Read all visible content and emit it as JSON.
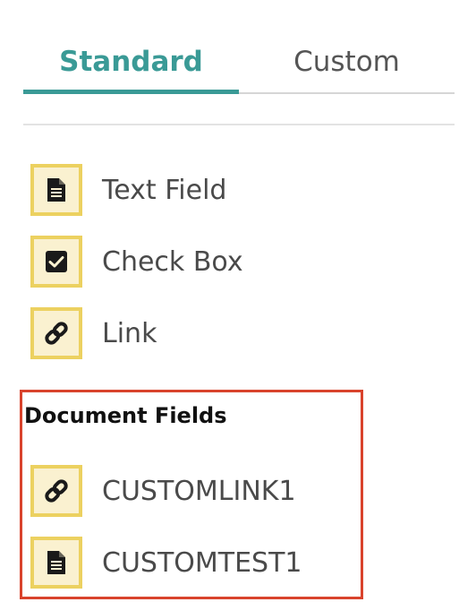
{
  "tabs": [
    {
      "label": "Standard",
      "active": true
    },
    {
      "label": "Custom",
      "active": false
    }
  ],
  "standard_fields": [
    {
      "label": "Text Field",
      "icon": "document-icon"
    },
    {
      "label": "Check Box",
      "icon": "checkbox-icon"
    },
    {
      "label": "Link",
      "icon": "link-icon"
    }
  ],
  "document_fields": {
    "title": "Document Fields",
    "items": [
      {
        "label": "CUSTOMLINK1",
        "icon": "link-icon"
      },
      {
        "label": "CUSTOMTEST1",
        "icon": "document-icon"
      }
    ]
  },
  "colors": {
    "accent": "#3a9a96",
    "icon_background": "#faf1d0",
    "icon_border": "#ecd160",
    "highlight_border": "#d9432c"
  }
}
